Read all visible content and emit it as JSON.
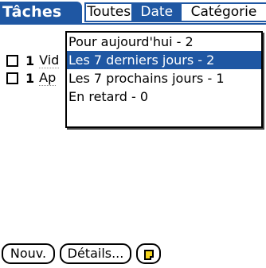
{
  "title": "Tâches",
  "views": [
    {
      "label": "Toutes",
      "selected": false
    },
    {
      "label": "Date",
      "selected": true
    },
    {
      "label": "Catégorie",
      "selected": false
    }
  ],
  "tasks": [
    {
      "priority": "1",
      "text": "Vid",
      "checked": false
    },
    {
      "priority": "1",
      "text": "Ap",
      "checked": false
    }
  ],
  "date_filter": {
    "options": [
      "Pour aujourd'hui - 2",
      "Les 7 derniers jours - 2",
      "Les 7 prochains jours - 1",
      "En retard - 0"
    ],
    "selected_index": 1
  },
  "buttons": {
    "new_label": "Nouv.",
    "details_label": "Détails..."
  },
  "icons": {
    "note": "note-icon",
    "checkbox": "checkbox-icon"
  },
  "colors": {
    "accent": "#1f57a3",
    "note": "#f5d51e"
  }
}
